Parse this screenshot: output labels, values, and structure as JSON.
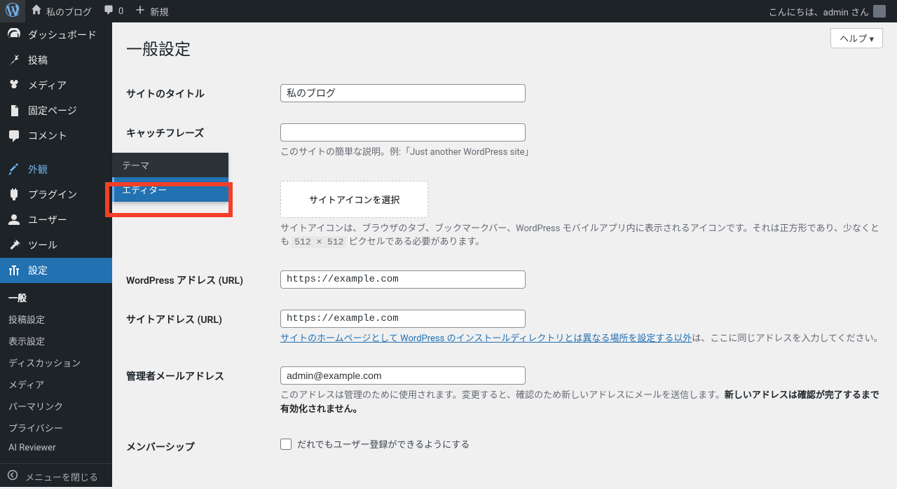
{
  "adminbar": {
    "site_name": "私のブログ",
    "comments": "0",
    "new": "新規",
    "greeting": "こんにちは、admin さん"
  },
  "sidebar": {
    "dashboard": "ダッシュボード",
    "posts": "投稿",
    "media": "メディア",
    "pages": "固定ページ",
    "comments": "コメント",
    "appearance": "外観",
    "plugins": "プラグイン",
    "users": "ユーザー",
    "tools": "ツール",
    "settings": "設定",
    "collapse": "メニューを閉じる"
  },
  "appearance_submenu": {
    "themes": "テーマ",
    "editor": "エディター"
  },
  "settings_submenu": {
    "general": "一般",
    "writing": "投稿設定",
    "reading": "表示設定",
    "discussion": "ディスカッション",
    "media": "メディア",
    "permalink": "パーマリンク",
    "privacy": "プライバシー",
    "ai_reviewer": "AI Reviewer"
  },
  "page": {
    "help": "ヘルプ ▾",
    "title": "一般設定"
  },
  "form": {
    "site_title_label": "サイトのタイトル",
    "site_title_value": "私のブログ",
    "tagline_label": "キャッチフレーズ",
    "tagline_value": "",
    "tagline_desc": "このサイトの簡単な説明。例:「Just another WordPress site」",
    "site_icon_button": "サイトアイコンを選択",
    "site_icon_desc_a": "サイトアイコンは、ブラウザのタブ、ブックマークバー、WordPress モバイルアプリ内に表示されるアイコンです。それは正方形であり、少なくとも ",
    "site_icon_code": "512 × 512",
    "site_icon_desc_b": " ピクセルである必要があります。",
    "wp_url_label": "WordPress アドレス (URL)",
    "wp_url_value": "https://example.com",
    "site_url_label": "サイトアドレス (URL)",
    "site_url_value": "https://example.com",
    "site_url_link": "サイトのホームページとして WordPress のインストールディレクトリとは異なる場所を設定する以外",
    "site_url_desc": "は、ここに同じアドレスを入力してください。",
    "admin_email_label": "管理者メールアドレス",
    "admin_email_value": "admin@example.com",
    "admin_email_desc_a": "このアドレスは管理のために使用されます。変更すると、確認のため新しいアドレスにメールを送信します。",
    "admin_email_desc_b": "新しいアドレスは確認が完了するまで有効化されません。",
    "membership_label": "メンバーシップ",
    "membership_check": "だれでもユーザー登録ができるようにする"
  }
}
